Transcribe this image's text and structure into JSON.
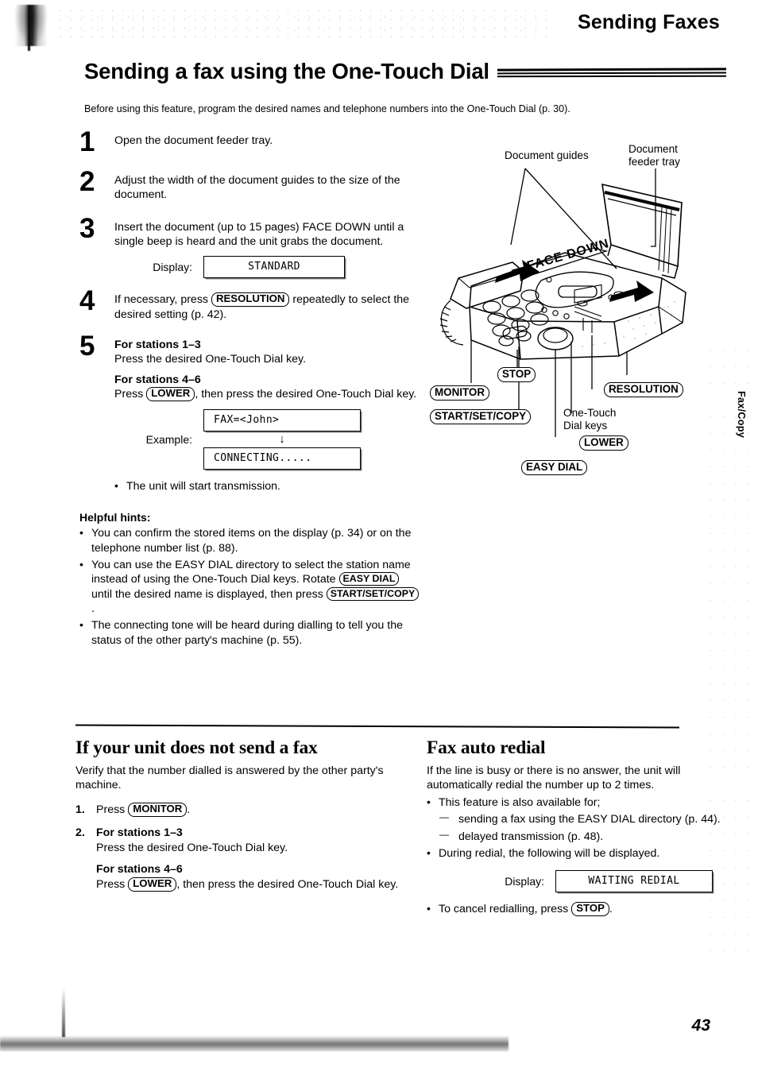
{
  "header": {
    "running_head": "Sending Faxes",
    "title": "Sending a fax using the One-Touch Dial",
    "intro": "Before using this feature, program the desired names and telephone numbers into the One-Touch Dial (p. 30)."
  },
  "steps": [
    {
      "num": "1",
      "text": "Open the document feeder tray."
    },
    {
      "num": "2",
      "text": "Adjust the width of the document guides to the size of the document."
    },
    {
      "num": "3",
      "text": "Insert the document (up to 15 pages) FACE DOWN until a single beep is heard and the unit grabs the document."
    },
    {
      "num": "4",
      "text_before": "If necessary, press",
      "key": "RESOLUTION",
      "text_after": "repeatedly to select the desired setting (p. 42)."
    },
    {
      "num": "5",
      "sub1_heading": "For stations 1–3",
      "sub1_text": "Press the desired One-Touch Dial key.",
      "sub2_heading": "For stations 4–6",
      "sub2_before": "Press",
      "sub2_key": "LOWER",
      "sub2_after": ", then press the desired One-Touch Dial key."
    }
  ],
  "display_standard": {
    "label": "Display:",
    "value": "STANDARD"
  },
  "display_example": {
    "label": "Example:",
    "value_1": "FAX=<John>",
    "arrow": "↓",
    "value_2": "CONNECTING....."
  },
  "after_example_bullet": "The unit will start transmission.",
  "hints": {
    "title": "Helpful hints:",
    "items": [
      {
        "text": "You can confirm the stored items on the display (p. 34) or on the telephone number list (p. 88)."
      },
      {
        "before": "You can use the EASY DIAL directory to select the station name instead of using the One-Touch Dial keys. Rotate",
        "key1": "EASY DIAL",
        "middle": "until the desired name is displayed, then press",
        "key2": "START/SET/COPY",
        "after": "."
      },
      {
        "text": "The connecting tone will be heard during dialling to tell you the status of the other party's machine (p. 55)."
      }
    ]
  },
  "figure": {
    "label_document_guides": "Document guides",
    "label_feeder_tray": "Document\nfeeder tray",
    "label_face_down": "FACE DOWN",
    "label_one_touch": "One-Touch\nDial keys",
    "keys": {
      "stop": "STOP",
      "monitor": "MONITOR",
      "start_set_copy": "START/SET/COPY",
      "easy_dial": "EASY DIAL",
      "lower": "LOWER",
      "resolution": "RESOLUTION"
    }
  },
  "side_tab": "Fax/Copy",
  "section_left": {
    "title": "If your unit does not send a fax",
    "intro": "Verify that the number dialled is answered by the other party's machine.",
    "item1": {
      "n": "1.",
      "before": "Press",
      "key": "MONITOR",
      "after": "."
    },
    "item2": {
      "n": "2.",
      "sub1_heading": "For stations 1–3",
      "sub1_text": "Press the desired One-Touch Dial key.",
      "sub2_heading": "For stations 4–6",
      "sub2_before": "Press",
      "sub2_key": "LOWER",
      "sub2_after": ", then press the desired One-Touch Dial key."
    }
  },
  "section_right": {
    "title": "Fax auto redial",
    "intro": "If the line is busy or there is no answer, the unit will automatically redial the number up to 2 times.",
    "bullet_available": "This feature is also available for;",
    "dash_1": "sending a fax using the EASY DIAL directory (p. 44).",
    "dash_2": "delayed transmission (p. 48).",
    "bullet_during": "During redial, the following will be displayed.",
    "display_label": "Display:",
    "display_value": "WAITING REDIAL",
    "bullet_cancel_before": "To cancel redialling, press",
    "bullet_cancel_key": "STOP",
    "bullet_cancel_after": "."
  },
  "page_number": "43"
}
